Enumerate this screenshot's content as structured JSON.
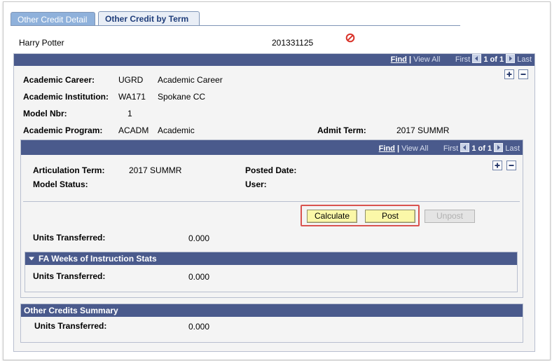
{
  "tabs": [
    {
      "label": "Other Credit Detail",
      "active": false
    },
    {
      "label": "Other Credit by Term",
      "active": true
    }
  ],
  "header": {
    "student_name": "Harry Potter",
    "student_id": "201331125",
    "status_icon": "prohibited-icon"
  },
  "outer_nav": {
    "find": "Find",
    "separator": "|",
    "view_all": "View All",
    "first": "First",
    "count": "1 of 1",
    "last": "Last"
  },
  "program": {
    "career_label": "Academic Career:",
    "career_code": "UGRD",
    "career_desc": "Academic Career",
    "institution_label": "Academic Institution:",
    "institution_code": "WA171",
    "institution_desc": "Spokane CC",
    "model_label": "Model Nbr:",
    "model_value": "1",
    "program_label": "Academic Program:",
    "program_code": "ACADM",
    "program_desc": "Academic",
    "admit_label": "Admit Term:",
    "admit_value": "2017 SUMMR"
  },
  "inner_nav": {
    "find": "Find",
    "separator": "|",
    "view_all": "View All",
    "first": "First",
    "count": "1 of 1",
    "last": "Last"
  },
  "term": {
    "artic_label": "Articulation Term:",
    "artic_value": "2017 SUMMR",
    "model_status_label": "Model Status:",
    "posted_label": "Posted Date:",
    "user_label": "User:"
  },
  "actions": {
    "calculate": "Calculate",
    "post": "Post",
    "unpost": "Unpost"
  },
  "units": {
    "label": "Units Transferred:",
    "value": "0.000"
  },
  "fa_weeks": {
    "title": "FA Weeks of Instruction Stats",
    "label": "Units Transferred:",
    "value": "0.000"
  },
  "summary": {
    "title": "Other Credits Summary",
    "label": "Units Transferred:",
    "value": "0.000"
  },
  "colors": {
    "bar": "#4a5a8c",
    "tab_inactive": "#8fb1db",
    "highlight": "#d9534f",
    "button_yellow": "#fbf8a8"
  }
}
